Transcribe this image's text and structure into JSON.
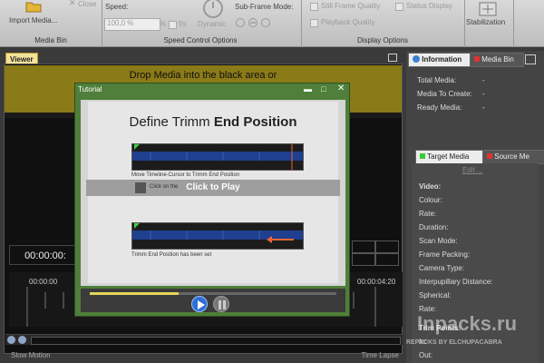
{
  "ribbon": {
    "import_media": "Import Media...",
    "close": "Close",
    "media_bin_group": "Media Bin",
    "speed_label": "Speed:",
    "speed_value": "100,0 %",
    "speed_unit_pct": "%",
    "speed_unit_fs": "f/s",
    "dynamic": "Dynamic",
    "sub_frame_mode": "Sub-Frame Mode:",
    "speed_group": "Speed Control Options",
    "still_frame_quality": "Still Frame Quality",
    "playback_quality": "Playback Quality",
    "status_display": "Status Display",
    "display_group": "Display Options",
    "stabilization": "Stabilization"
  },
  "viewer": {
    "tab": "Viewer",
    "drop_text": "Drop Media into the black area or",
    "timecode": "00:00:00:",
    "ruler_start": "00:00:00",
    "ruler_end": "00:00:04:20",
    "bottom_left": "Slow Motion",
    "bottom_right": "Time Lapse"
  },
  "right_panel": {
    "tab_information": "Information",
    "tab_media_bin": "Media Bin",
    "info_rows": [
      {
        "label": "Total Media:",
        "value": "-"
      },
      {
        "label": "Media To Create:",
        "value": "-"
      },
      {
        "label": "Ready Media:",
        "value": "-"
      }
    ],
    "tab_target": "Target Media",
    "tab_source": "Source Me",
    "edit": "Edit ...",
    "video_header": "Video:",
    "props": [
      "Colour:",
      "Rate:",
      "Duration:",
      "Scan Mode:",
      "Frame Packing:",
      "Camera Type:",
      "Interpupillary Distance:",
      "Spherical:",
      "Rate:",
      "Trim Points:",
      "In:",
      "Out:"
    ]
  },
  "dialog": {
    "title": "Tutorial",
    "slide_title_prefix": "Define Trimm ",
    "slide_title_bold": "End Position",
    "caption1": "Move Timeline-Cursor to Trimm End Position",
    "caption_partial": "Click on the",
    "click_to_play": "Click to Play",
    "caption2": "Trimm End Position has been set",
    "progress": 0.36
  },
  "watermark": {
    "line1": "Inpacks.ru",
    "line2": "REPACKS BY ELCHUPACABRA"
  }
}
